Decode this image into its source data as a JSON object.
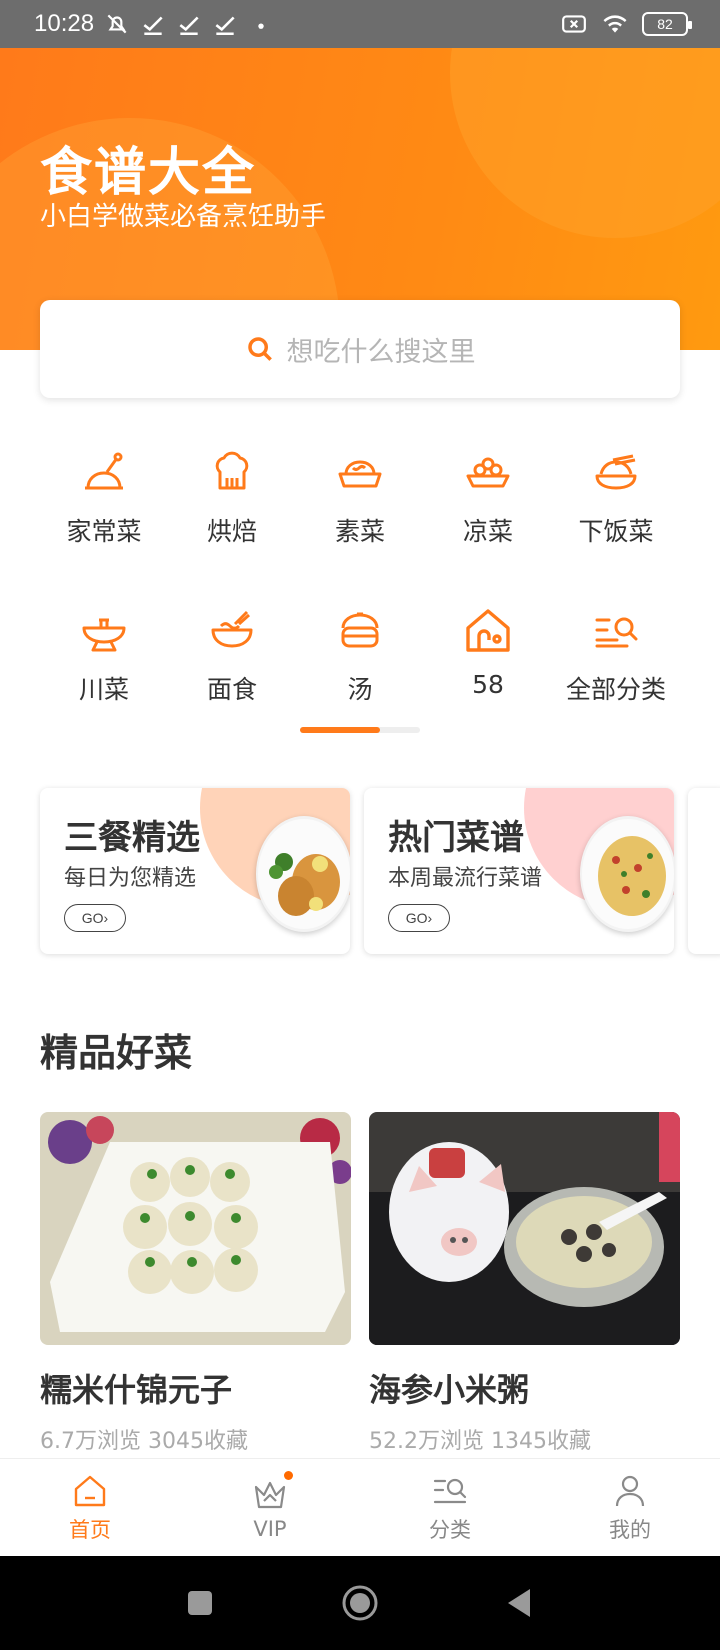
{
  "status_bar": {
    "time": "10:28",
    "battery": "82",
    "left_icons": [
      "notifications-off-icon",
      "check-icon",
      "check-icon",
      "check-icon",
      "dot-icon"
    ],
    "right_icons": [
      "sim-off-icon",
      "wifi-icon",
      "battery-icon"
    ]
  },
  "hero": {
    "title": "食谱大全",
    "subtitle": "小白学做菜必备烹饪助手",
    "gradient_colors": [
      "#ff7a1a",
      "#ff9a10"
    ]
  },
  "search": {
    "placeholder": "想吃什么搜这里",
    "icon": "search-icon"
  },
  "categories": [
    {
      "label": "家常菜",
      "icon": "home-dish-icon"
    },
    {
      "label": "烘焙",
      "icon": "bakery-icon"
    },
    {
      "label": "素菜",
      "icon": "vegetable-dish-icon"
    },
    {
      "label": "凉菜",
      "icon": "cold-dish-icon"
    },
    {
      "label": "下饭菜",
      "icon": "rice-dish-icon"
    },
    {
      "label": "川菜",
      "icon": "sichuan-dish-icon"
    },
    {
      "label": "面食",
      "icon": "noodle-icon"
    },
    {
      "label": "汤",
      "icon": "soup-icon"
    },
    {
      "label": "58",
      "icon": "house-icon"
    },
    {
      "label": "全部分类",
      "icon": "category-search-icon"
    }
  ],
  "category_pager": {
    "page": 1,
    "pages": 2
  },
  "promos": [
    {
      "title": "三餐精选",
      "subtitle": "每日为您精选",
      "go": "GO›",
      "accent": "#ffd3b8"
    },
    {
      "title": "热门菜谱",
      "subtitle": "本周最流行菜谱",
      "go": "GO›",
      "accent": "#ffd0d0"
    }
  ],
  "section": {
    "title": "精品好菜"
  },
  "dishes": [
    {
      "name": "糯米什锦元子",
      "meta": "6.7万浏览 3045收藏"
    },
    {
      "name": "海参小米粥",
      "meta": "52.2万浏览 1345收藏"
    }
  ],
  "bottom_nav": [
    {
      "label": "首页",
      "icon": "home-icon",
      "active": true
    },
    {
      "label": "VIP",
      "icon": "crown-icon",
      "active": false,
      "badge": true
    },
    {
      "label": "分类",
      "icon": "category-list-icon",
      "active": false
    },
    {
      "label": "我的",
      "icon": "profile-icon",
      "active": false
    }
  ],
  "accent_color": "#ff7a1a"
}
